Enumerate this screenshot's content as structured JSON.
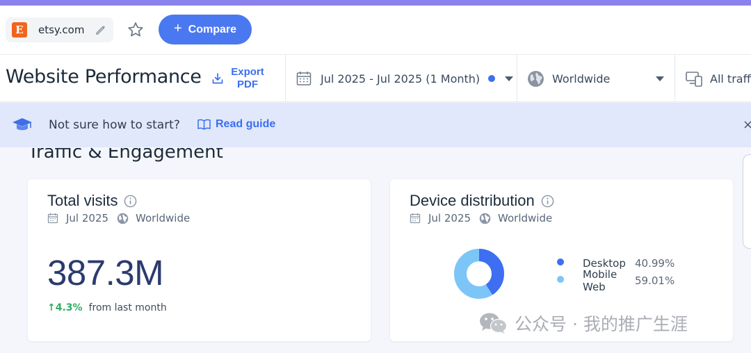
{
  "site": {
    "domain": "etsy.com",
    "logo_letter": "E"
  },
  "header": {
    "compare_label": "Compare",
    "compare_icon": "plus-icon"
  },
  "toolbar": {
    "page_title": "Website Performance",
    "export_label": "Export PDF",
    "date_range": "Jul 2025 - Jul 2025 (1 Month)",
    "region": "Worldwide",
    "traffic": "All traffic"
  },
  "guide": {
    "question": "Not sure how to start?",
    "read_label": "Read guide",
    "close_glyph": "×"
  },
  "section": {
    "title": "Traffic & Engagement"
  },
  "visits_card": {
    "title": "Total visits",
    "period": "Jul 2025",
    "region": "Worldwide",
    "value": "387.3M",
    "change": "↑4.3%",
    "change_suffix": "from last month"
  },
  "device_card": {
    "title": "Device distribution",
    "period": "Jul 2025",
    "region": "Worldwide",
    "chart_data": {
      "type": "pie",
      "categories": [
        "Desktop",
        "Mobile Web"
      ],
      "values": [
        40.99,
        59.01
      ],
      "colors": [
        "#3e6ef2",
        "#7cc5f7"
      ]
    },
    "legend": [
      {
        "name": "Desktop",
        "pct": "40.99%",
        "color": "#3e6ef2"
      },
      {
        "name": "Mobile Web",
        "pct": "59.01%",
        "color": "#7cc5f7"
      }
    ]
  },
  "watermark": {
    "text": "公众号 · 我的推广生涯"
  },
  "colors": {
    "accent": "#3a6ff0",
    "stripe": "#8a82ec",
    "guide_bg": "#e1e8fb",
    "positive": "#2fae61",
    "etsy": "#f1641e"
  }
}
